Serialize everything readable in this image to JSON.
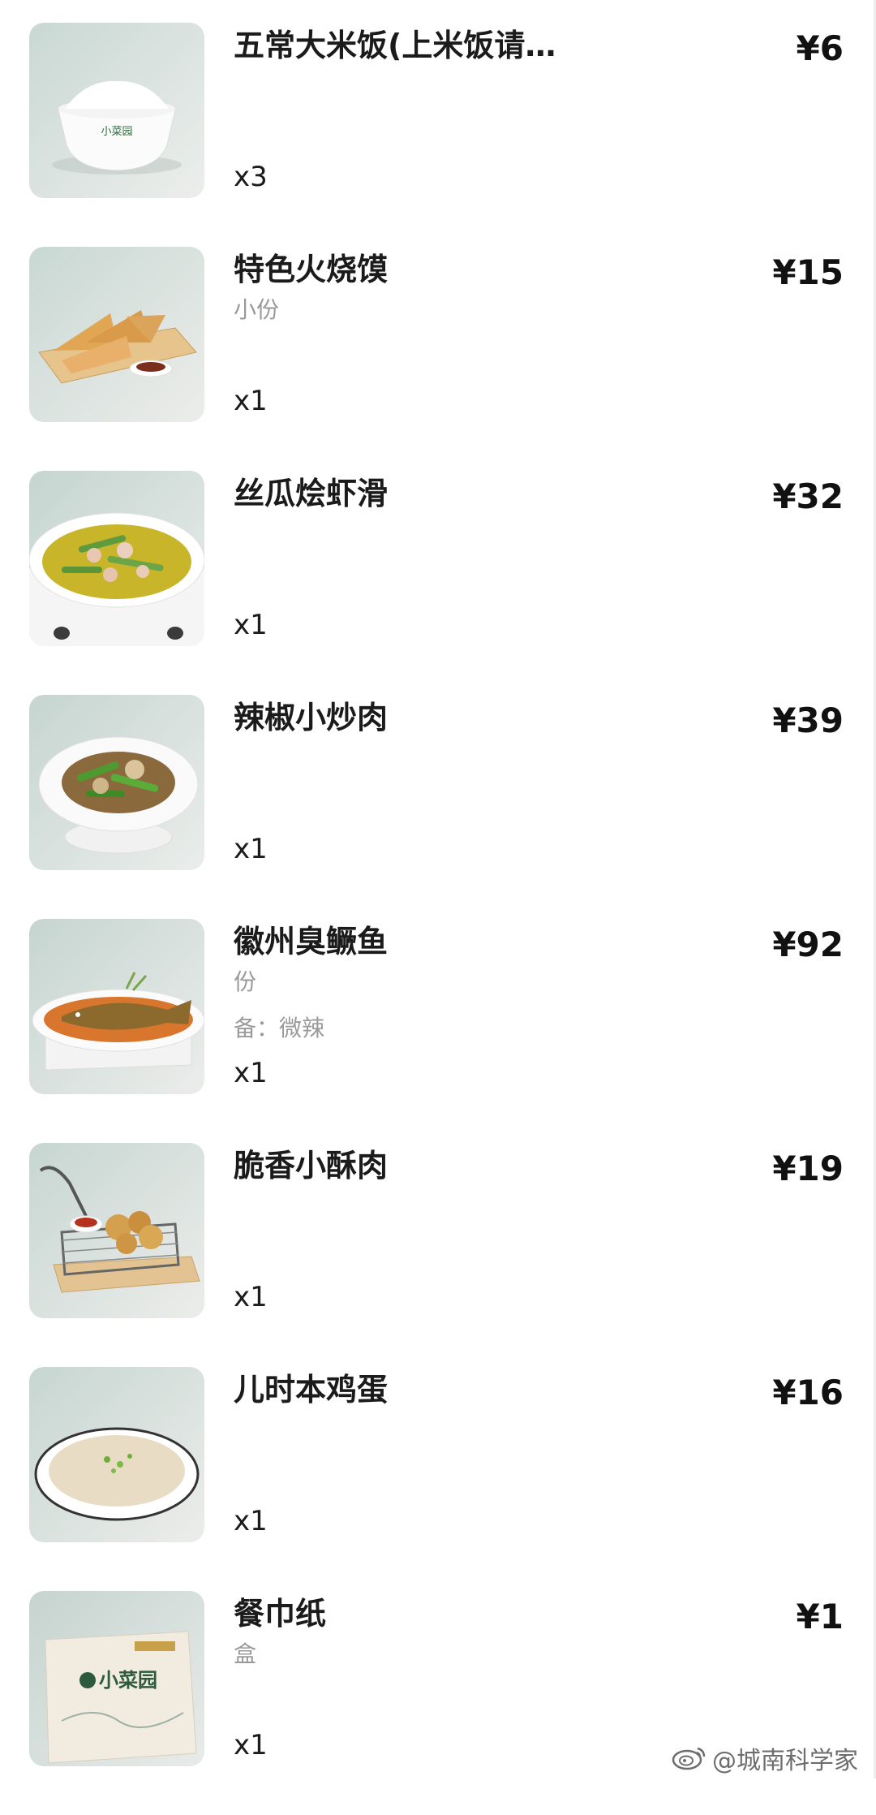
{
  "order_items": [
    {
      "name": "五常大米饭(上米饭请…",
      "spec": "",
      "note": "",
      "qty": "x3",
      "price": "¥6",
      "image_icon": "rice-bowl-icon"
    },
    {
      "name": "特色火烧馍",
      "spec": "小份",
      "note": "",
      "qty": "x1",
      "price": "¥15",
      "image_icon": "flatbread-icon"
    },
    {
      "name": "丝瓜烩虾滑",
      "spec": "",
      "note": "",
      "qty": "x1",
      "price": "¥32",
      "image_icon": "soup-pot-icon"
    },
    {
      "name": "辣椒小炒肉",
      "spec": "",
      "note": "",
      "qty": "x1",
      "price": "¥39",
      "image_icon": "stir-fry-plate-icon"
    },
    {
      "name": "徽州臭鳜鱼",
      "spec": "份",
      "note": "备：微辣",
      "qty": "x1",
      "price": "¥92",
      "image_icon": "fish-plate-icon"
    },
    {
      "name": "脆香小酥肉",
      "spec": "",
      "note": "",
      "qty": "x1",
      "price": "¥19",
      "image_icon": "fry-basket-icon"
    },
    {
      "name": "儿时本鸡蛋",
      "spec": "",
      "note": "",
      "qty": "x1",
      "price": "¥16",
      "image_icon": "steamed-egg-icon"
    },
    {
      "name": "餐巾纸",
      "spec": "盒",
      "note": "",
      "qty": "x1",
      "price": "¥1",
      "image_icon": "tissue-box-icon"
    }
  ],
  "brand_text": "小菜园",
  "watermark": {
    "text": "@城南科学家",
    "icon": "weibo-icon"
  }
}
